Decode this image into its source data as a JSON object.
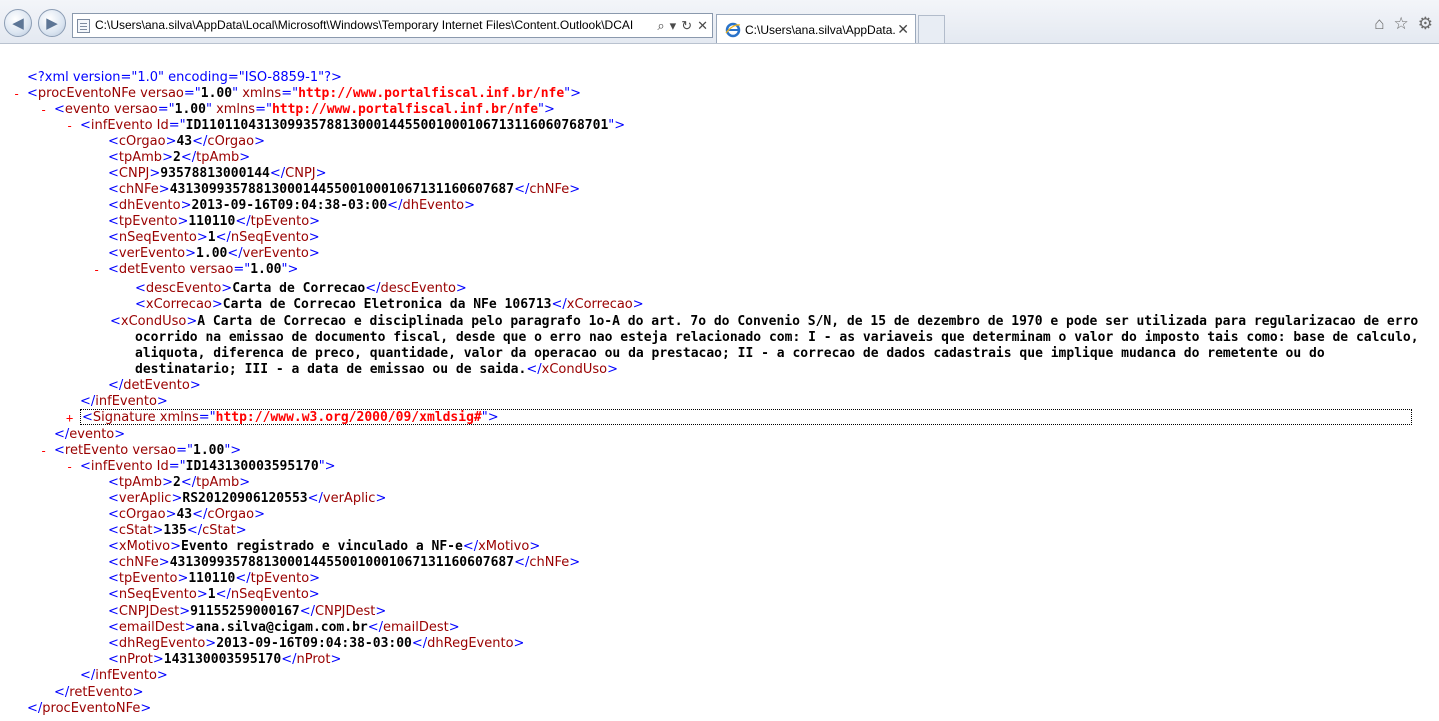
{
  "browser": {
    "address": "C:\\Users\\ana.silva\\AppData\\Local\\Microsoft\\Windows\\Temporary Internet Files\\Content.Outlook\\DCAI",
    "tab_title": "C:\\Users\\ana.silva\\AppData....",
    "nav": {
      "back": "◀",
      "forward": "▶"
    },
    "addr_tools": {
      "search": "⌕",
      "dropdown": "▾",
      "refresh": "↻",
      "stop": "✕"
    },
    "tab_close": "✕",
    "right_tools": {
      "home": "⌂",
      "favorites": "☆",
      "settings": "⚙"
    }
  },
  "xml": {
    "decl": "<?xml version=\"1.0\" encoding=\"ISO-8859-1\"?>",
    "procEventoNFe": {
      "tag": "procEventoNFe",
      "attr": "versao",
      "attr_val": "1.00",
      "xmlns": "xmlns",
      "xmlns_val": "http://www.portalfiscal.inf.br/nfe"
    },
    "evento": {
      "tag": "evento",
      "attr": "versao",
      "attr_val": "1.00",
      "xmlns": "xmlns",
      "xmlns_val": "http://www.portalfiscal.inf.br/nfe"
    },
    "infEvento1": {
      "tag": "infEvento",
      "attr": "Id",
      "attr_val": "ID1101104313099357881300014455001000106713116060768701"
    },
    "ev": {
      "cOrgao": "43",
      "tpAmb": "2",
      "CNPJ": "93578813000144",
      "chNFe": "43130993578813000144550010001067131160607687",
      "dhEvento": "2013-09-16T09:04:38-03:00",
      "tpEvento": "110110",
      "nSeqEvento": "1",
      "verEvento": "1.00"
    },
    "detEvento": {
      "tag": "detEvento",
      "attr": "versao",
      "attr_val": "1.00"
    },
    "det": {
      "descEvento": "Carta de Correcao",
      "xCorrecao": "Carta de Correcao Eletronica da NFe 106713",
      "xCondUso": "A Carta de Correcao e disciplinada pelo paragrafo 1o-A do art. 7o do Convenio S/N, de 15 de dezembro de 1970 e pode ser utilizada para regularizacao de erro ocorrido na emissao de documento fiscal, desde que o erro nao esteja relacionado com: I - as variaveis que determinam o valor do imposto tais como: base de calculo, aliquota, diferenca de preco, quantidade, valor da operacao ou da prestacao; II - a correcao de dados cadastrais que implique mudanca do remetente ou do destinatario; III - a data de emissao ou de saida."
    },
    "signature": {
      "tag": "Signature",
      "xmlns": "xmlns",
      "xmlns_val": "http://www.w3.org/2000/09/xmldsig#"
    },
    "retEvento": {
      "tag": "retEvento",
      "attr": "versao",
      "attr_val": "1.00"
    },
    "infEvento2": {
      "tag": "infEvento",
      "attr": "Id",
      "attr_val": "ID143130003595170"
    },
    "ret": {
      "tpAmb": "2",
      "verAplic": "RS20120906120553",
      "cOrgao": "43",
      "cStat": "135",
      "xMotivo": "Evento registrado e vinculado a NF-e",
      "chNFe": "43130993578813000144550010001067131160607687",
      "tpEvento": "110110",
      "nSeqEvento": "1",
      "CNPJDest": "91155259000167",
      "emailDest": "ana.silva@cigam.com.br",
      "dhRegEvento": "2013-09-16T09:04:38-03:00",
      "nProt": "143130003595170"
    },
    "toggles": {
      "minus": "-",
      "plus": "+"
    }
  },
  "colors": {
    "bracket": "#0000ff",
    "name": "#990000",
    "namespace": "#ff0000",
    "toggle": "#ff0000"
  }
}
